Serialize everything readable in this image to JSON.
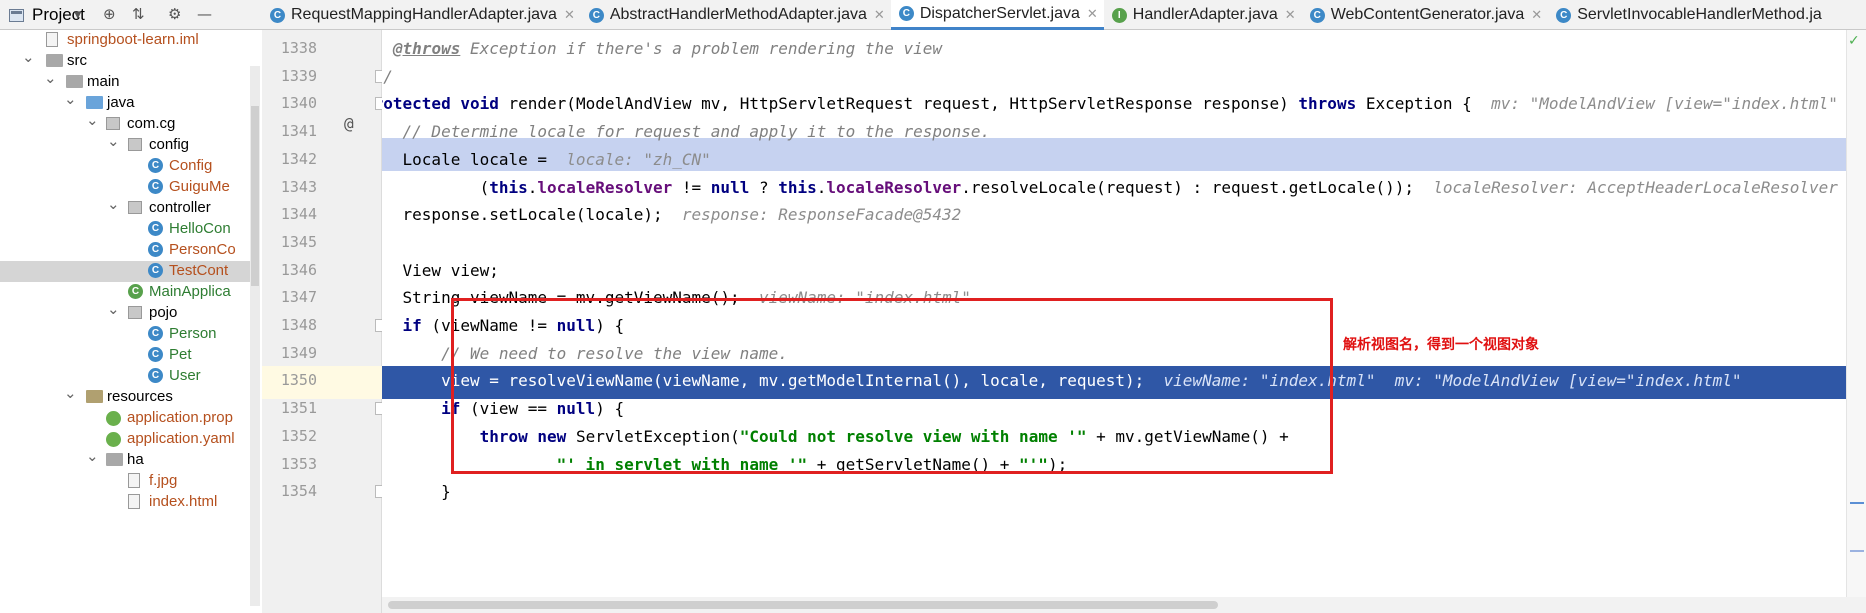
{
  "project_panel": {
    "title": "Project",
    "tree": [
      {
        "label": "springboot-learn.iml",
        "icon": "iml-file-icon",
        "color": "#b5501e"
      },
      {
        "label": "src",
        "icon": "folder-icon",
        "color": "#000000"
      },
      {
        "label": "main",
        "icon": "folder-icon",
        "color": "#000000"
      },
      {
        "label": "java",
        "icon": "source-folder-icon",
        "color": "#000000"
      },
      {
        "label": "com.cg",
        "icon": "package-icon",
        "color": "#000000"
      },
      {
        "label": "config",
        "icon": "package-icon",
        "color": "#000000"
      },
      {
        "label": "Config",
        "icon": "class-icon",
        "color": "#b5501e"
      },
      {
        "label": "GuiguMe",
        "icon": "class-icon",
        "color": "#b5501e"
      },
      {
        "label": "controller",
        "icon": "package-icon",
        "color": "#000000"
      },
      {
        "label": "HelloCon",
        "icon": "class-icon",
        "color": "#2e7d32"
      },
      {
        "label": "PersonCo",
        "icon": "class-icon",
        "color": "#b5501e"
      },
      {
        "label": "TestCont",
        "icon": "class-icon",
        "color": "#b5501e"
      },
      {
        "label": "MainApplica",
        "icon": "spring-boot-class-icon",
        "color": "#2e7d32"
      },
      {
        "label": "pojo",
        "icon": "package-icon",
        "color": "#000000"
      },
      {
        "label": "Person",
        "icon": "class-icon",
        "color": "#2e7d32"
      },
      {
        "label": "Pet",
        "icon": "class-icon",
        "color": "#2e7d32"
      },
      {
        "label": "User",
        "icon": "class-icon",
        "color": "#2e7d32"
      },
      {
        "label": "resources",
        "icon": "resources-folder-icon",
        "color": "#000000"
      },
      {
        "label": "application.prop",
        "icon": "spring-config-icon",
        "color": "#b5501e"
      },
      {
        "label": "application.yaml",
        "icon": "spring-config-icon",
        "color": "#b5501e"
      },
      {
        "label": "ha",
        "icon": "folder-icon",
        "color": "#000000"
      },
      {
        "label": "f.jpg",
        "icon": "image-file-icon",
        "color": "#b5501e"
      },
      {
        "label": "index.html",
        "icon": "html-file-icon",
        "color": "#b5501e"
      }
    ]
  },
  "tabs": [
    {
      "label": "RequestMappingHandlerAdapter.java",
      "icon": "C",
      "icon_kind": "class"
    },
    {
      "label": "AbstractHandlerMethodAdapter.java",
      "icon": "C",
      "icon_kind": "class"
    },
    {
      "label": "DispatcherServlet.java",
      "icon": "C",
      "icon_kind": "class",
      "active": true
    },
    {
      "label": "HandlerAdapter.java",
      "icon": "I",
      "icon_kind": "interface"
    },
    {
      "label": "WebContentGenerator.java",
      "icon": "C",
      "icon_kind": "class"
    },
    {
      "label": "ServletInvocableHandlerMethod.ja",
      "icon": "C",
      "icon_kind": "class"
    }
  ],
  "line_numbers": [
    "1338",
    "1339",
    "1340",
    "1341",
    "1342",
    "1343",
    "1344",
    "1345",
    "1346",
    "1347",
    "1348",
    "1349",
    "1350",
    "1351",
    "1352",
    "1353",
    "1354"
  ],
  "code": [
    [
      {
        "t": " * ",
        "c": "cm"
      },
      {
        "t": "@throws",
        "c": "cm-tag"
      },
      {
        "t": " Exception if there's a problem rendering the view",
        "c": "cm"
      }
    ],
    [
      {
        "t": " */",
        "c": "cm"
      }
    ],
    [
      {
        "t": "protected",
        "c": "kw"
      },
      {
        "t": " "
      },
      {
        "t": "void",
        "c": "kw"
      },
      {
        "t": " render(ModelAndView mv, HttpServletRequest request, HttpServletResponse response) "
      },
      {
        "t": "throws",
        "c": "kw"
      },
      {
        "t": " Exception {  "
      },
      {
        "t": "mv: \"ModelAndView [view=\"index.html\"",
        "c": "hint"
      }
    ],
    [
      {
        "t": "    // Determine locale for request and apply it to the response.",
        "c": "cm"
      }
    ],
    [
      {
        "t": "    Locale locale =  "
      },
      {
        "t": "locale: \"zh_CN\"",
        "c": "hint"
      }
    ],
    [
      {
        "t": "            ("
      },
      {
        "t": "this",
        "c": "kw"
      },
      {
        "t": "."
      },
      {
        "t": "localeResolver",
        "c": "fld"
      },
      {
        "t": " != "
      },
      {
        "t": "null",
        "c": "kw"
      },
      {
        "t": " ? "
      },
      {
        "t": "this",
        "c": "kw"
      },
      {
        "t": "."
      },
      {
        "t": "localeResolver",
        "c": "fld"
      },
      {
        "t": ".resolveLocale(request) : request.getLocale());  "
      },
      {
        "t": "localeResolver: AcceptHeaderLocaleResolver",
        "c": "hint"
      }
    ],
    [
      {
        "t": "    response.setLocale(locale);  "
      },
      {
        "t": "response: ResponseFacade@5432",
        "c": "hint"
      }
    ],
    [
      {
        "t": ""
      }
    ],
    [
      {
        "t": "    View view;"
      }
    ],
    [
      {
        "t": "    String viewName = mv.getViewName();  "
      },
      {
        "t": "viewName: \"index.html\"",
        "c": "hint"
      }
    ],
    [
      {
        "t": "    "
      },
      {
        "t": "if",
        "c": "kw"
      },
      {
        "t": " (viewName != "
      },
      {
        "t": "null",
        "c": "kw"
      },
      {
        "t": ") {"
      }
    ],
    [
      {
        "t": "        // We need to resolve the view name.",
        "c": "cm"
      }
    ],
    [
      {
        "t": "        view = resolveViewName(viewName, mv.getModelInternal(), locale, request);",
        "c": "sel-text"
      },
      {
        "t": "  viewName: \"index.html\"  mv: \"ModelAndView [view=\"index.html\"",
        "c": "sel-hint"
      }
    ],
    [
      {
        "t": "        "
      },
      {
        "t": "if",
        "c": "kw"
      },
      {
        "t": " (view == "
      },
      {
        "t": "null",
        "c": "kw"
      },
      {
        "t": ") {"
      }
    ],
    [
      {
        "t": "            "
      },
      {
        "t": "throw",
        "c": "kw"
      },
      {
        "t": " "
      },
      {
        "t": "new",
        "c": "kw"
      },
      {
        "t": " ServletException("
      },
      {
        "t": "\"Could not resolve view with name '\"",
        "c": "str"
      },
      {
        "t": " + mv.getViewName() +"
      }
    ],
    [
      {
        "t": "                    "
      },
      {
        "t": "\"' in servlet with name '\"",
        "c": "str"
      },
      {
        "t": " + getServletName() + "
      },
      {
        "t": "\"'\"",
        "c": "str"
      },
      {
        "t": ");"
      }
    ],
    [
      {
        "t": "        }"
      }
    ]
  ],
  "annotation": "解析视图名，得到一个视图对象",
  "colors": {
    "keyword": "#000080",
    "comment": "#808080",
    "string": "#008000",
    "field": "#660e7a",
    "selected_line": "#2f57a6",
    "breakpoint_line": "#c6d2f0",
    "annotation_box": "#e02020"
  }
}
